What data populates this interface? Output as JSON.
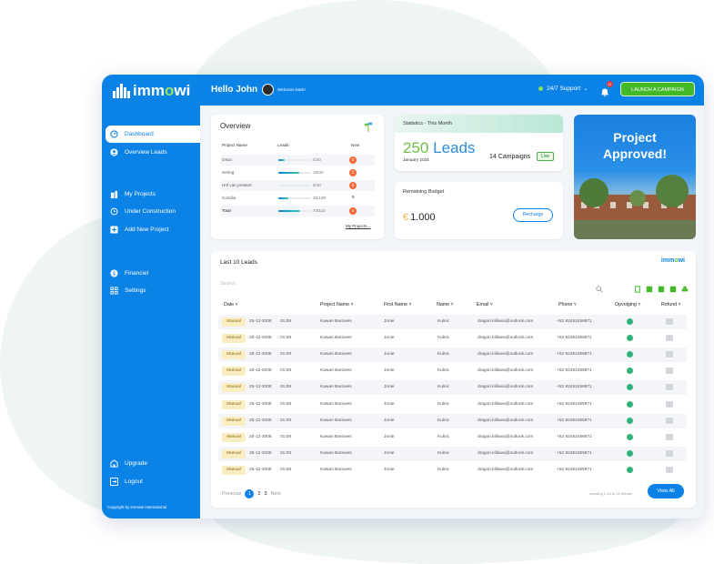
{
  "brand": {
    "name_prefix": "imm",
    "name_o": "o",
    "name_suffix": "wi",
    "accent": "#0b82e6",
    "green": "#43b928"
  },
  "header": {
    "greeting": "Hello John",
    "welcome": "Welcome back!",
    "support": "24/7 Support",
    "notifications": "11",
    "launch": "LAUNCH A CAMPAIGN"
  },
  "sidebar": {
    "items": [
      {
        "label": "Dashboard",
        "icon": "dashboard-icon"
      },
      {
        "label": "Overview Leads",
        "icon": "user-circle-icon"
      },
      {
        "label": "My Projects",
        "icon": "buildings-icon"
      },
      {
        "label": "Under Construction",
        "icon": "history-icon"
      },
      {
        "label": "Add New Project",
        "icon": "plus-square-icon"
      },
      {
        "label": "Financiel",
        "icon": "dollar-icon"
      },
      {
        "label": "Settings",
        "icon": "settings-icon"
      },
      {
        "label": "Upgrade",
        "icon": "building-icon"
      },
      {
        "label": "Logout",
        "icon": "logout-icon"
      }
    ],
    "copyright": "Copyright by Immowi International"
  },
  "overview": {
    "title": "Overview",
    "columns": [
      "Project Name",
      "Leads",
      "New"
    ],
    "rows": [
      {
        "name": "Osca",
        "count": "4/20",
        "fill": 0.2,
        "new": "3",
        "badge": true
      },
      {
        "name": "Sering",
        "count": "19/30",
        "fill": 0.63,
        "new": "2",
        "badge": true
      },
      {
        "name": "Hof van prestort",
        "count": "0/10",
        "fill": 0.0,
        "new": "5",
        "badge": true
      },
      {
        "name": "Corsilio",
        "count": "30/100",
        "fill": 0.3,
        "new": "9",
        "badge": false
      },
      {
        "name": "Total",
        "count": "73/110",
        "fill": 0.66,
        "new": "4",
        "badge": true
      }
    ],
    "link": "My Projects..."
  },
  "stats": {
    "title": "Statistics - This Month",
    "leads_number": "250",
    "leads_label": "Leads",
    "period": "January 2021",
    "campaigns": "14 Campaigns",
    "status": "Live"
  },
  "budget": {
    "title": "Remaining Budget",
    "currency": "€",
    "amount": "1.000",
    "button": "Recharge"
  },
  "promo": {
    "line1": "Project",
    "line2": "Approved!"
  },
  "leads_table": {
    "title": "Last 10 Leads",
    "search_placeholder": "Search",
    "columns": [
      "Date",
      "Project Name",
      "First Name",
      "Name",
      "Email",
      "Phone",
      "Opvolging",
      "Refund"
    ],
    "rows": [
      {
        "tag": "Manual",
        "date": "25-12-2008",
        "time": "01:08",
        "project": "Kawan Barowes",
        "first": "Jonie",
        "name": "Kulnic",
        "email": "dragon.killawa@outlook.com",
        "phone": "+52 82452456871"
      },
      {
        "tag": "Manual",
        "date": "25-12-2008",
        "time": "01:08",
        "project": "Kawan Barowes",
        "first": "Jonie",
        "name": "Kulnic",
        "email": "dragon.killawa@outlook.com",
        "phone": "+52 82452456871"
      },
      {
        "tag": "Manual",
        "date": "25-12-2008",
        "time": "01:08",
        "project": "Kawan Barowes",
        "first": "Jonie",
        "name": "Kulnic",
        "email": "dragon.killawa@outlook.com",
        "phone": "+52 82452456871"
      },
      {
        "tag": "Manual",
        "date": "25-12-2008",
        "time": "01:08",
        "project": "Kawan Barowes",
        "first": "Jonie",
        "name": "Kulnic",
        "email": "dragon.killawa@outlook.com",
        "phone": "+52 82452456871"
      },
      {
        "tag": "Manual",
        "date": "25-12-2008",
        "time": "01:08",
        "project": "Kawan Barowes",
        "first": "Jonie",
        "name": "Kulnic",
        "email": "dragon.killawa@outlook.com",
        "phone": "+52 82452456871"
      },
      {
        "tag": "Manual",
        "date": "25-12-2008",
        "time": "01:08",
        "project": "Kawan Barowes",
        "first": "Jonie",
        "name": "Kulnic",
        "email": "dragon.killawa@outlook.com",
        "phone": "+52 82452456871"
      },
      {
        "tag": "Manual",
        "date": "25-12-2008",
        "time": "01:08",
        "project": "Kawan Barowes",
        "first": "Jonie",
        "name": "Kulnic",
        "email": "dragon.killawa@outlook.com",
        "phone": "+52 82452456871"
      },
      {
        "tag": "Manual",
        "date": "25-12-2008",
        "time": "01:08",
        "project": "Kawan Barowes",
        "first": "Jonie",
        "name": "Kulnic",
        "email": "dragon.killawa@outlook.com",
        "phone": "+52 82452456871"
      },
      {
        "tag": "Manual",
        "date": "25-12-2008",
        "time": "01:08",
        "project": "Kawan Barowes",
        "first": "Jonie",
        "name": "Kulnic",
        "email": "dragon.killawa@outlook.com",
        "phone": "+52 82452456871"
      },
      {
        "tag": "Manual",
        "date": "25-12-2008",
        "time": "01:08",
        "project": "Kawan Barowes",
        "first": "Jonie",
        "name": "Kulnic",
        "email": "dragon.killawa@outlook.com",
        "phone": "+52 82452456871"
      }
    ],
    "pagination": {
      "prev": "Previous",
      "pages": [
        "1",
        "2",
        "3"
      ],
      "current": "1",
      "next": "Next"
    },
    "showing": "showing 1-10 of 10 entries",
    "view_all": "View All"
  }
}
